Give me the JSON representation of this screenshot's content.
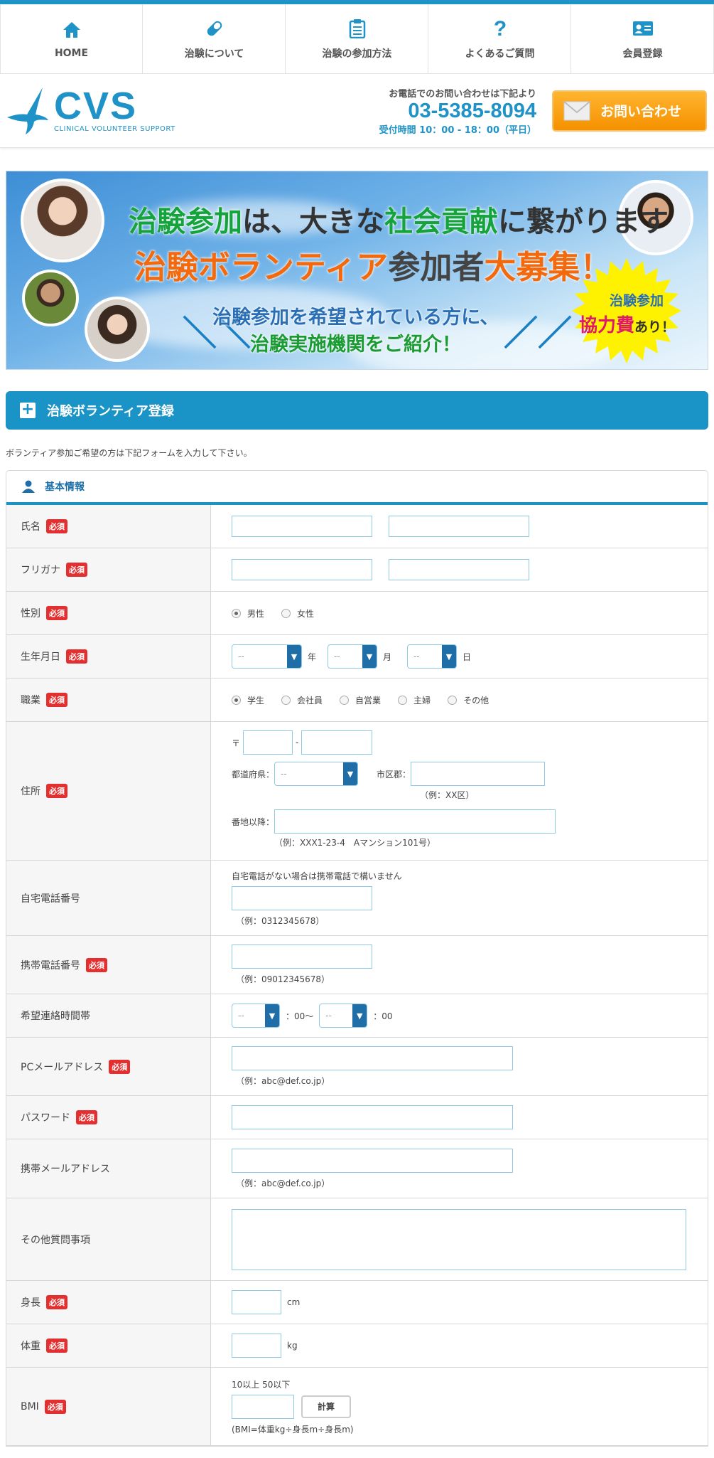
{
  "nav": [
    {
      "label": "HOME",
      "icon": "home-icon"
    },
    {
      "label": "治験について",
      "icon": "capsule-icon"
    },
    {
      "label": "治験の参加方法",
      "icon": "clipboard-icon"
    },
    {
      "label": "よくあるご質問",
      "icon": "question-icon"
    },
    {
      "label": "会員登録",
      "icon": "member-card-icon"
    }
  ],
  "header": {
    "logo_main": "CVS",
    "logo_sub": "CLINICAL VOLUNTEER SUPPORT",
    "tel_note": "お電話でのお問い合わせは下記より",
    "tel_number": "03-5385-8094",
    "tel_hours": "受付時間 10：00 - 18：00（平日）",
    "inquiry_label": "お問い合わせ"
  },
  "banner": {
    "l1_a": "治験参加",
    "l1_b": "は、大きな",
    "l1_c": "社会貢献",
    "l1_d": "に繋がります",
    "l2_a": "治験ボランティア",
    "l2_b": "参加者",
    "l2_c": "大募集",
    "l2_d": "！",
    "sub1": "治験参加を希望されている方に、",
    "sub2": "治験実施機関をご紹介！",
    "star1": "治験参加",
    "star2": "協力費",
    "star3": "あり！"
  },
  "section_title": "治験ボランティア登録",
  "intro": "ボランティア参加ご希望の方は下記フォームを入力して下さい。",
  "card_title": "基本情報",
  "required": "必須",
  "form": {
    "name": "氏名",
    "kana": "フリガナ",
    "gender": "性別",
    "gender_opts": [
      "男性",
      "女性"
    ],
    "birth": "生年月日",
    "year": "年",
    "month": "月",
    "day": "日",
    "select_placeholder": "--",
    "job": "職業",
    "job_opts": [
      "学生",
      "会社員",
      "自営業",
      "主婦",
      "その他"
    ],
    "address": "住所",
    "postal_mark": "〒",
    "dash": "-",
    "pref": "都道府県：",
    "city": "市区郡：",
    "city_example": "（例：XX区）",
    "street": "番地以降：",
    "street_example": "（例：XXX1-23-4　Aマンション101号）",
    "home_tel": "自宅電話番号",
    "home_tel_note": "自宅電話がない場合は携帯電話で構いません",
    "home_tel_example": "（例：0312345678）",
    "mobile_tel": "携帯電話番号",
    "mobile_tel_example": "（例：09012345678）",
    "contact_time": "希望連絡時間帯",
    "time_from": "：00〜",
    "time_to": "：00",
    "pc_mail": "PCメールアドレス",
    "pc_mail_example": "（例：abc@def.co.jp）",
    "password": "パスワード",
    "mobile_mail": "携帯メールアドレス",
    "mobile_mail_example": "（例：abc@def.co.jp）",
    "other": "その他質問事項",
    "height": "身長",
    "height_unit": "cm",
    "weight": "体重",
    "weight_unit": "kg",
    "bmi": "BMI",
    "bmi_range": "10以上 50以下",
    "calc_label": "計算",
    "bmi_formula": "(BMI=体重kg÷身長m÷身長m)"
  },
  "colors": {
    "accent": "#1f93c7",
    "required": "#e32f2f",
    "button": "#f59100"
  }
}
